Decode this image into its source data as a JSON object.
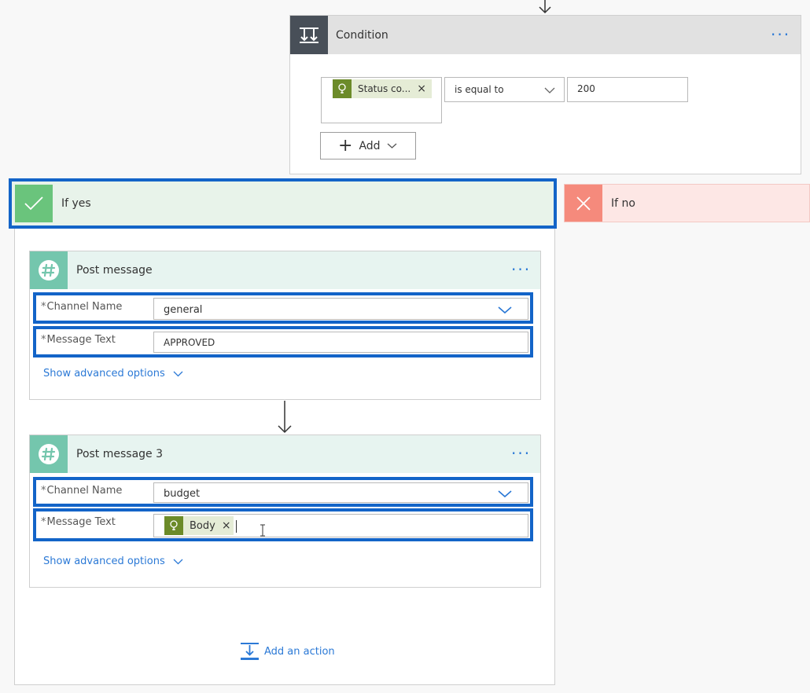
{
  "condition": {
    "title": "Condition",
    "token_label": "Status co...",
    "token_remove": "×",
    "operator": "is equal to",
    "value": "200",
    "add_label": "Add",
    "more": "···"
  },
  "if_yes": {
    "label": "If yes"
  },
  "if_no": {
    "label": "If no"
  },
  "post1": {
    "title": "Post message",
    "more": "···",
    "channel_label": "Channel Name",
    "channel_value": "general",
    "message_label": "Message Text",
    "message_value": "APPROVED",
    "advanced": "Show advanced options"
  },
  "post2": {
    "title": "Post message 3",
    "more": "···",
    "channel_label": "Channel Name",
    "channel_value": "budget",
    "message_label": "Message Text",
    "message_token": "Body",
    "message_token_remove": "×",
    "advanced": "Show advanced options"
  },
  "add_action": {
    "label": "Add an action"
  },
  "required_mark": "*",
  "colors": {
    "condition_header": "#e1e1e1",
    "condition_icon_bg": "#484f58",
    "if_yes_bg": "#e8f3ea",
    "if_yes_icon": "#6ac47c",
    "if_no_bg": "#fde7e5",
    "if_no_icon": "#f58a7c",
    "action_header": "#e7f4f0",
    "slack_icon": "#74c6ad",
    "highlight": "#1364c8",
    "link": "#2b79d6"
  }
}
